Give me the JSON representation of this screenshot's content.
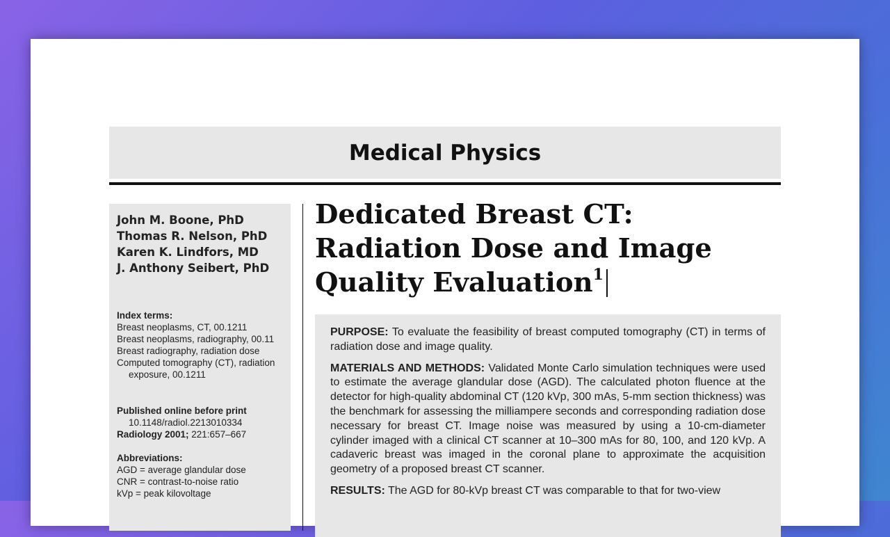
{
  "journal": {
    "section": "Medical Physics"
  },
  "authors": [
    "John M. Boone, PhD",
    "Thomas R. Nelson, PhD",
    "Karen K. Lindfors, MD",
    "J. Anthony Seibert, PhD"
  ],
  "index_terms": {
    "label": "Index terms:",
    "items": [
      "Breast neoplasms, CT, 00.1211",
      "Breast neoplasms, radiography, 00.11",
      "Breast radiography, radiation dose",
      "Computed tomography (CT), radiation exposure, 00.1211"
    ]
  },
  "publication": {
    "label": "Published online before print",
    "doi": "10.1148/radiol.2213010334",
    "journal_name": "Radiology 2001;",
    "citation": " 221:657–667"
  },
  "abbreviations": {
    "label": "Abbreviations:",
    "items": [
      "AGD = average glandular dose",
      "CNR = contrast-to-noise ratio",
      "kVp = peak kilovoltage"
    ]
  },
  "article": {
    "title_line1": "Dedicated Breast CT:",
    "title_line2": "Radiation Dose and Image",
    "title_line3": "Quality Evaluation",
    "footnote_mark": "1"
  },
  "abstract": {
    "purpose_label": "PURPOSE:",
    "purpose_text": " To evaluate the feasibility of breast computed tomography (CT) in terms of radiation dose and image quality.",
    "methods_label": "MATERIALS AND METHODS:",
    "methods_text": " Validated Monte Carlo simulation techniques were used to estimate the average glandular dose (AGD). The calculated photon fluence at the detector for high-quality abdominal CT (120 kVp, 300 mAs, 5-mm section thickness) was the benchmark for assessing the milliampere seconds and corresponding radiation dose necessary for breast CT. Image noise was measured by using a 10-cm-diameter cylinder imaged with a clinical CT scanner at 10–300 mAs for 80, 100, and 120 kVp. A cadaveric breast was imaged in the coronal plane to approximate the acquisition geometry of a proposed breast CT scanner.",
    "results_label": "RESULTS:",
    "results_text": " The AGD for 80-kVp breast CT was comparable to that for two-view"
  }
}
